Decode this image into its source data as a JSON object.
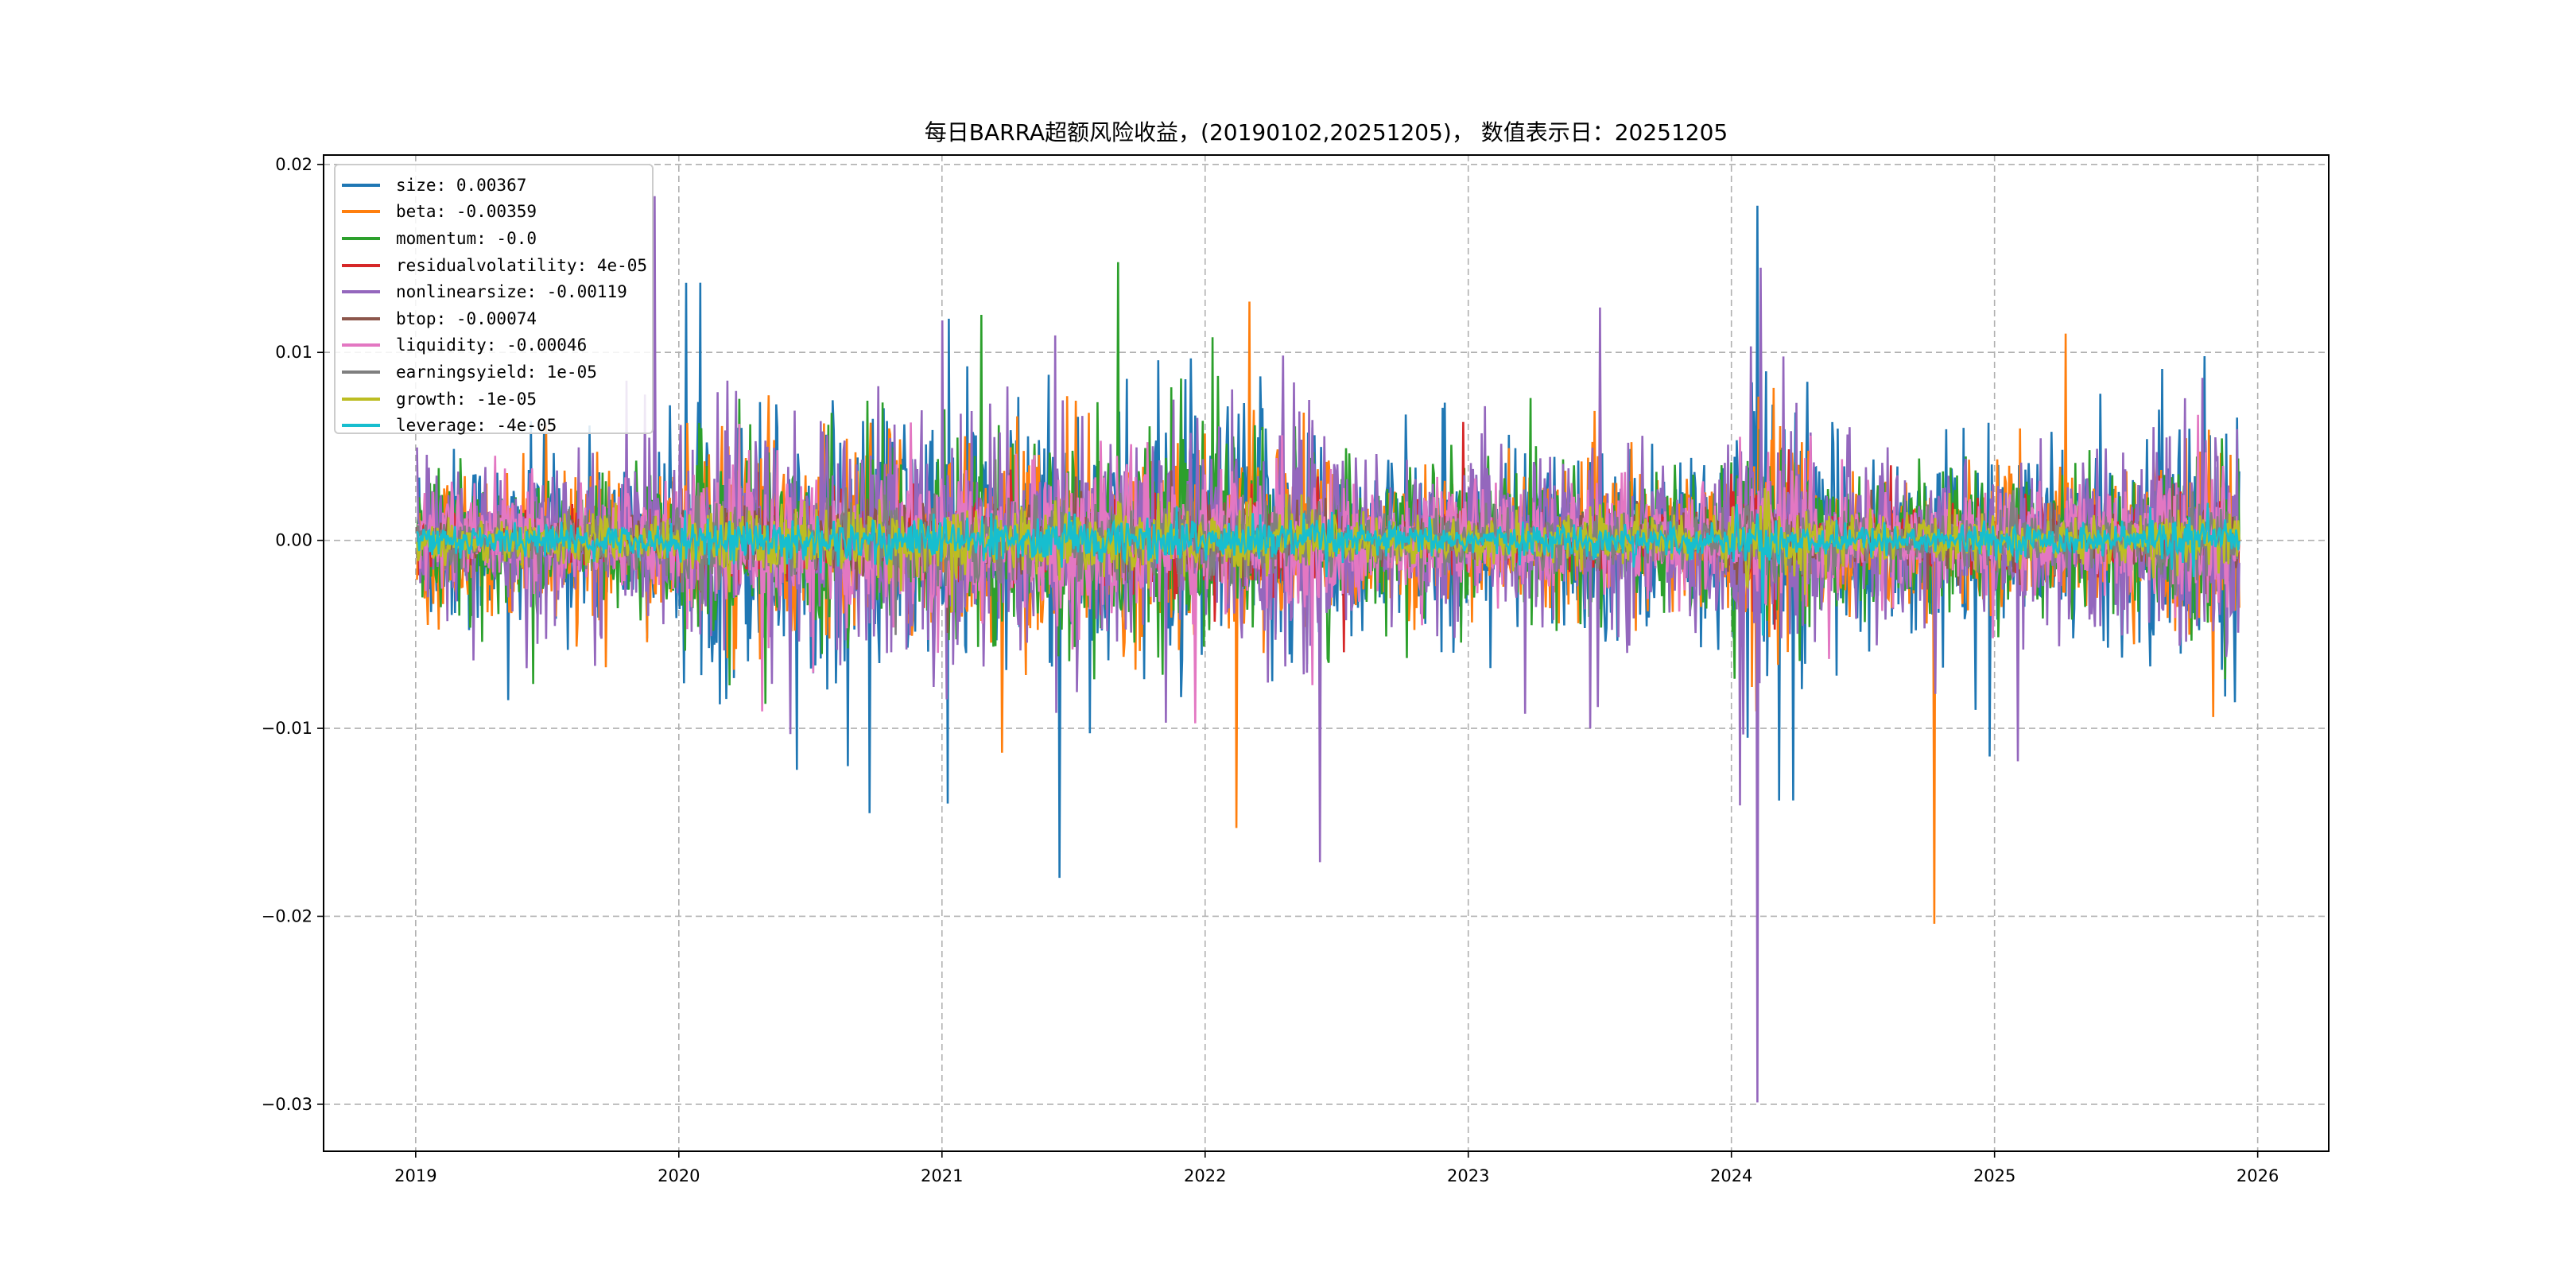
{
  "chart_data": {
    "type": "line",
    "title": "每日BARRA超额风险收益，(20190102,20251205)， 数值表示日：20251205",
    "xlabel": "",
    "ylabel": "",
    "x_range": [
      "2019-01-02",
      "2025-12-05"
    ],
    "xlim": [
      2018.65,
      2026.27
    ],
    "ylim": [
      -0.0325,
      0.0205
    ],
    "xticks": [
      "2019",
      "2020",
      "2021",
      "2022",
      "2023",
      "2024",
      "2025",
      "2026"
    ],
    "yticks": [
      {
        "v": 0.02,
        "label": "0.02"
      },
      {
        "v": 0.01,
        "label": "0.01"
      },
      {
        "v": 0,
        "label": "0.00"
      },
      {
        "v": -0.01,
        "label": "−0.01"
      },
      {
        "v": -0.02,
        "label": "−0.02"
      },
      {
        "v": -0.03,
        "label": "−0.03"
      }
    ],
    "grid": true,
    "legend_position": "top-left",
    "series": [
      {
        "name": "size",
        "legend": "size: 0.00367",
        "color": "#1f77b4",
        "last": 0.00367,
        "vol": 0.0024,
        "spikes": [
          [
            2019.35,
            -0.0085
          ],
          [
            2021.02,
            -0.014
          ],
          [
            2024.1,
            0.0178
          ],
          [
            2024.06,
            -0.0105
          ],
          [
            2024.98,
            -0.0115
          ],
          [
            2025.8,
            0.0098
          ]
        ]
      },
      {
        "name": "beta",
        "legend": "beta: -0.00359",
        "color": "#ff7f0e",
        "last": -0.00359,
        "vol": 0.0018,
        "spikes": [
          [
            2022.17,
            0.0127
          ],
          [
            2022.12,
            -0.0153
          ],
          [
            2024.77,
            -0.0204
          ],
          [
            2025.27,
            0.011
          ],
          [
            2025.83,
            -0.0094
          ]
        ]
      },
      {
        "name": "momentum",
        "legend": "momentum: -0.0",
        "color": "#2ca02c",
        "last": 0.0,
        "vol": 0.0018,
        "spikes": [
          [
            2021.15,
            0.012
          ],
          [
            2021.67,
            0.0148
          ],
          [
            2020.33,
            -0.0087
          ],
          [
            2022.03,
            0.0108
          ]
        ]
      },
      {
        "name": "residualvolatility",
        "legend": "residualvolatility: 4e-05",
        "color": "#d62728",
        "last": 4e-05,
        "vol": 0.0008,
        "spikes": [
          [
            2022.98,
            0.0063
          ]
        ]
      },
      {
        "name": "nonlinearsize",
        "legend": "nonlinearsize: -0.00119",
        "color": "#9467bd",
        "last": -0.00119,
        "vol": 0.0022,
        "spikes": [
          [
            2021.0,
            0.0117
          ],
          [
            2024.1,
            -0.0299
          ],
          [
            2024.11,
            0.0145
          ],
          [
            2019.8,
            0.0085
          ],
          [
            2021.85,
            -0.0097
          ]
        ]
      },
      {
        "name": "btop",
        "legend": "btop: -0.00074",
        "color": "#8c564b",
        "last": -0.00074,
        "vol": 0.0006,
        "spikes": []
      },
      {
        "name": "liquidity",
        "legend": "liquidity: -0.00046",
        "color": "#e377c2",
        "last": -0.00046,
        "vol": 0.0013,
        "spikes": [
          [
            2019.3,
            0.0045
          ]
        ]
      },
      {
        "name": "earningsyield",
        "legend": "earningsyield: 1e-05",
        "color": "#7f7f7f",
        "last": 1e-05,
        "vol": 0.0007,
        "spikes": []
      },
      {
        "name": "growth",
        "legend": "growth: -1e-05",
        "color": "#bcbd22",
        "last": -1e-05,
        "vol": 0.0006,
        "spikes": []
      },
      {
        "name": "leverage",
        "legend": "leverage: -4e-05",
        "color": "#17becf",
        "last": -4e-05,
        "vol": 0.0004,
        "spikes": []
      }
    ]
  }
}
